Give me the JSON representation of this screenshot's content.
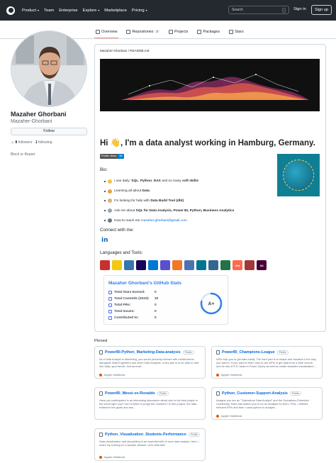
{
  "header": {
    "nav": [
      {
        "label": "Product",
        "caret": true
      },
      {
        "label": "Team",
        "caret": false
      },
      {
        "label": "Enterprise",
        "caret": false
      },
      {
        "label": "Explore",
        "caret": true
      },
      {
        "label": "Marketplace",
        "caret": false
      },
      {
        "label": "Pricing",
        "caret": true
      }
    ],
    "search_placeholder": "Search",
    "search_shortcut": "/",
    "signin": "Sign in",
    "signup": "Sign up"
  },
  "tabs": [
    {
      "label": "Overview",
      "count": "",
      "icon": "book-icon"
    },
    {
      "label": "Repositories",
      "count": "7",
      "icon": "repo-icon"
    },
    {
      "label": "Projects",
      "count": "",
      "icon": "table-icon"
    },
    {
      "label": "Packages",
      "count": "",
      "icon": "package-icon"
    },
    {
      "label": "Stars",
      "count": "",
      "icon": "star-icon"
    }
  ],
  "profile": {
    "name": "Mazaher Ghorbani",
    "login": "Mazaher-Ghorbani",
    "follow": "Follow",
    "followers_count": "8",
    "followers_label": "followers",
    "following_count": "1",
    "following_label": "following",
    "block_report": "Block or Report"
  },
  "readme": {
    "path": "Mazaher-Ghorbani / README.md",
    "title": "Hi 👋, I'm a data analyst working in Hamburg, Germany.",
    "badge_label": "Profile views",
    "badge_value": "98",
    "bio_heading": "Bio:",
    "bio": [
      {
        "emoji_color": "#f5c242",
        "parts": [
          {
            "t": "I use daily: ",
            "b": false
          },
          {
            "t": "SQL",
            "b": true
          },
          {
            "t": ", ",
            "b": false
          },
          {
            "t": "Python",
            "b": true
          },
          {
            "t": ", ",
            "b": false
          },
          {
            "t": "DAX",
            "b": true
          },
          {
            "t": " and so many ",
            "b": false
          },
          {
            "t": "soft skills",
            "b": true
          },
          {
            "t": "!",
            "b": false
          }
        ]
      },
      {
        "emoji_color": "#e8a33d",
        "parts": [
          {
            "t": "Learning all about ",
            "b": false
          },
          {
            "t": "Data",
            "b": true
          }
        ]
      },
      {
        "emoji_color": "#d6b37a",
        "parts": [
          {
            "t": "I'm looking for help with ",
            "b": false
          },
          {
            "t": "Data Build Tool (dbt)",
            "b": true
          }
        ]
      },
      {
        "emoji_color": "#9aa4af",
        "parts": [
          {
            "t": "Ask me about ",
            "b": false
          },
          {
            "t": "SQL for Data Analysis, Power BI, Python, Business Analytics",
            "b": true
          }
        ]
      },
      {
        "emoji_color": "#6e7781",
        "parts": [
          {
            "t": "How to reach me ",
            "b": false
          },
          {
            "t": "mazaher.ghorbani@gmail.com",
            "b": false,
            "link": true
          }
        ]
      }
    ],
    "connect_heading": "Connect with me:",
    "linkedin_glyph": "in",
    "tools_heading": "Languages and Tools:",
    "tools": [
      {
        "name": "sql-server-icon",
        "color": "#c9302c",
        "glyph": ""
      },
      {
        "name": "power-bi-icon",
        "color": "#f2c811",
        "glyph": ""
      },
      {
        "name": "python-icon",
        "color": "#3776ab",
        "glyph": ""
      },
      {
        "name": "pandas-icon",
        "color": "#150458",
        "glyph": ""
      },
      {
        "name": "azure-icon",
        "color": "#0078d4",
        "glyph": ""
      },
      {
        "name": "dax-icon",
        "color": "#5a4fcf",
        "glyph": ""
      },
      {
        "name": "jupyter-icon",
        "color": "#f37626",
        "glyph": ""
      },
      {
        "name": "seaborn-icon",
        "color": "#4c72b0",
        "glyph": ""
      },
      {
        "name": "mysql-icon",
        "color": "#00758f",
        "glyph": ""
      },
      {
        "name": "postgresql-icon",
        "color": "#336791",
        "glyph": ""
      },
      {
        "name": "excel-icon",
        "color": "#217346",
        "glyph": ""
      },
      {
        "name": "dbt-icon",
        "color": "#ff694b",
        "glyph": "dbt"
      },
      {
        "name": "access-icon",
        "color": "#a4373a",
        "glyph": ""
      },
      {
        "name": "xd-icon",
        "color": "#470137",
        "glyph": "Xd"
      }
    ],
    "stats": {
      "title": "Mazaher Ghorbani's GitHub Stats",
      "rows": [
        {
          "label": "Total Stars Earned:",
          "value": "0"
        },
        {
          "label": "Total Commits (2022):",
          "value": "32"
        },
        {
          "label": "Total PRs:",
          "value": "0"
        },
        {
          "label": "Total Issues:",
          "value": "0"
        },
        {
          "label": "Contributed to:",
          "value": "0"
        }
      ],
      "grade": "A+",
      "grade_progress": 0.78
    }
  },
  "pinned": {
    "heading": "Pinned",
    "items": [
      {
        "name": "PowerBI-Python_Marketing-Data-analysis",
        "visibility": "Public",
        "desc": "As a Data Analyst in Marketing, you would primarily interact with media teams alongside Data Engineers and other Data Analysts. A key skill is to be able to dive into daily, spot trends, find anomal...",
        "lang": "Jupyter Notebook"
      },
      {
        "name": "PowerBI_Champions-League",
        "visibility": "Public",
        "desc": "APIs help you to get data easily. The hard part is to shape and visualize it the way you want it. If you want to learn how to use APIs to get data from a Web source, and do lots of ETL tasks in Power Query as well as create beautiful visualization...",
        "lang": "Jupyter Notebook"
      },
      {
        "name": "PowerBI_Messi-vs-Ronaldo",
        "visibility": "Public",
        "desc": "Have you participated in an interesting discussion about who is the best player in the world right now? Isn't it better to judge the numbers? In this project, the data related to the goals and ass...",
        "lang": ""
      },
      {
        "name": "Python_Customer-Support-Analysis",
        "visibility": "Public",
        "desc": "Imagine you are an \"Operations Data Analyst\" and the Operations Extended Leadership Team has tasked you to do an analysis for them. First, I defined relevant KPIs and then I used python to analyze...",
        "lang": "Jupyter Notebook"
      },
      {
        "name": "Python_Visualization_Students-Performance",
        "visibility": "Public",
        "desc": "Data visualization and storytelling is an essential skill of each data analyst. Here I share my training on a sample dataset. Let's data talk!",
        "lang": "Jupyter Notebook"
      }
    ]
  },
  "colors": {
    "header_bg": "#24292f",
    "link": "#0969da",
    "tab_underline": "#fd8c73",
    "banner_bg": "#101010",
    "jupyter_dot": "#DA5B0B",
    "stats_accent": "#2f80ed"
  }
}
